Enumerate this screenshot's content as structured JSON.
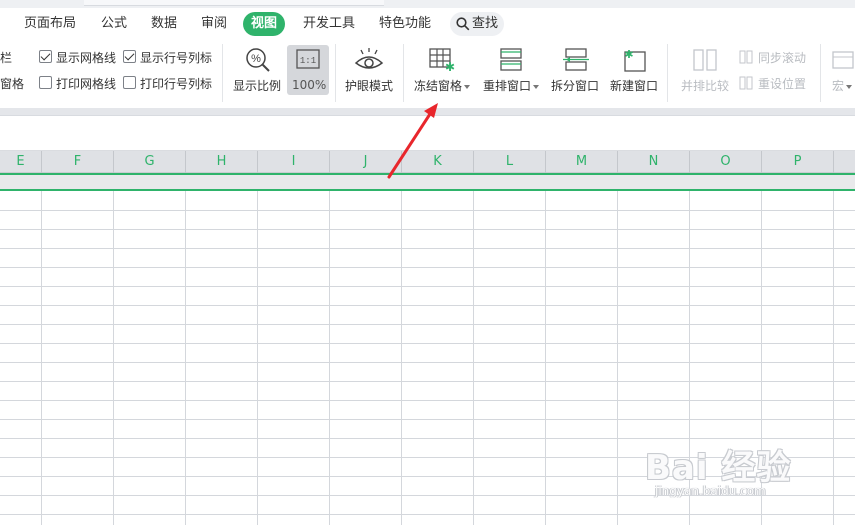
{
  "menu": {
    "tabs": [
      "页面布局",
      "公式",
      "数据",
      "审阅",
      "视图",
      "开发工具",
      "特色功能"
    ],
    "active_tab": "视图",
    "search_label": "查找"
  },
  "ribbon": {
    "partial_top": "栏",
    "partial_bottom": "窗格",
    "show_gridlines": "显示网格线",
    "show_headers": "显示行号列标",
    "print_gridlines": "打印网格线",
    "print_headers": "打印行号列标",
    "zoom_label": "显示比例",
    "zoom_value": "100%",
    "eye_mode": "护眼模式",
    "freeze_panes": "冻结窗格",
    "arrange_windows": "重排窗口",
    "split_window": "拆分窗口",
    "new_window": "新建窗口",
    "side_by_side": "并排比较",
    "sync_scroll": "同步滚动",
    "reset_position": "重设位置",
    "macro": "宏"
  },
  "sheet": {
    "columns": [
      "E",
      "F",
      "G",
      "H",
      "I",
      "J",
      "K",
      "L",
      "M",
      "N",
      "O",
      "P"
    ]
  },
  "watermark": {
    "main": "Bai 经验",
    "sub": "jingyan.baidu.com"
  },
  "colors": {
    "accent": "#2fb36b",
    "arrow": "#e8262c"
  }
}
